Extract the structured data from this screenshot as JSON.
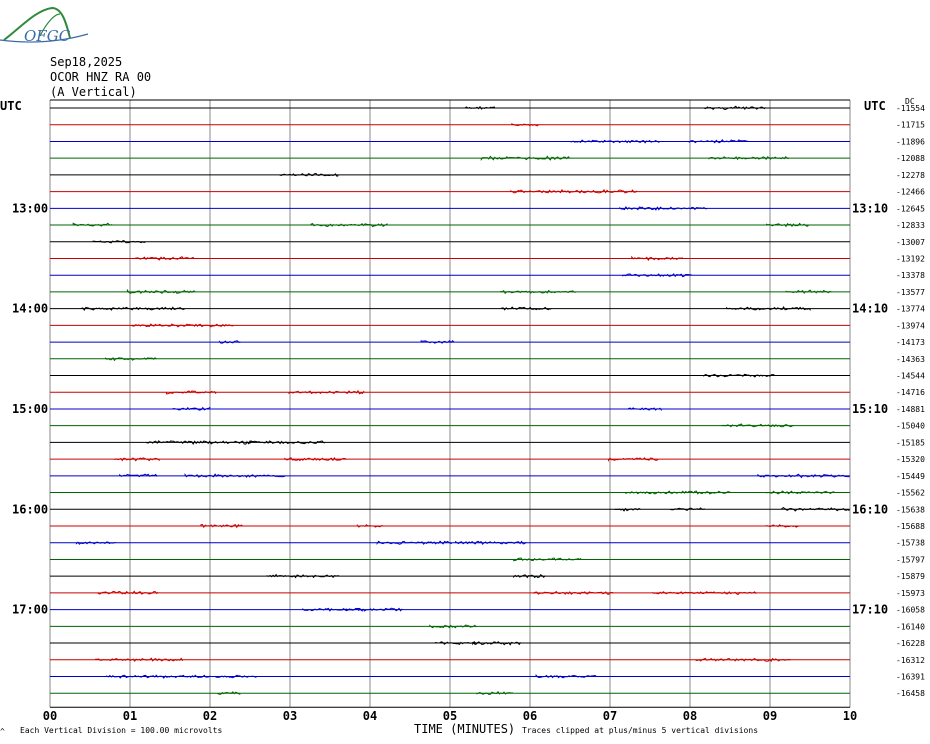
{
  "logo": {
    "text": "OFGC",
    "leaf_color": "#2f8a3a",
    "text_color": "#3a6aa8"
  },
  "header": {
    "date": "Sep18,2025",
    "station": "OCOR HNZ RA 00",
    "component": "(A Vertical)"
  },
  "left_label": "UTC",
  "right_label": "UTC",
  "dc_label": "DC",
  "footer": {
    "scale_note": "Each Vertical Division =  100.00 microvolts",
    "x_title": "TIME (MINUTES)",
    "clip_note": "Traces clipped at plus/minus 5 vertical divisions"
  },
  "chart_data": {
    "type": "helicorder",
    "x_ticks": [
      "00",
      "01",
      "02",
      "03",
      "04",
      "05",
      "06",
      "07",
      "08",
      "09",
      "10"
    ],
    "xlim": [
      0,
      10
    ],
    "trace_colors": [
      "#000000",
      "#cc0000",
      "#0000cc",
      "#006600"
    ],
    "grid_color": "#888888",
    "time_labels_left": [
      {
        "label": "13:00",
        "row": 6
      },
      {
        "label": "14:00",
        "row": 12
      },
      {
        "label": "15:00",
        "row": 18
      },
      {
        "label": "16:00",
        "row": 24
      },
      {
        "label": "17:00",
        "row": 30
      }
    ],
    "time_labels_right": [
      {
        "label": "13:10",
        "row": 6
      },
      {
        "label": "14:10",
        "row": 12
      },
      {
        "label": "15:10",
        "row": 18
      },
      {
        "label": "16:10",
        "row": 24
      },
      {
        "label": "17:10",
        "row": 30
      }
    ],
    "dc_offsets": [
      "-11554",
      "-11715",
      "-11896",
      "-12088",
      "-12278",
      "-12466",
      "-12645",
      "-12833",
      "-13007",
      "-13192",
      "-13378",
      "-13577",
      "-13774",
      "-13974",
      "-14173",
      "-14363",
      "-14544",
      "-14716",
      "-14881",
      "-15040",
      "-15185",
      "-15320",
      "-15449",
      "-15562",
      "-15638",
      "-15688",
      "-15738",
      "-15797",
      "-15879",
      "-15973",
      "-16058",
      "-16140",
      "-16228",
      "-16312",
      "-16391",
      "-16458"
    ]
  }
}
